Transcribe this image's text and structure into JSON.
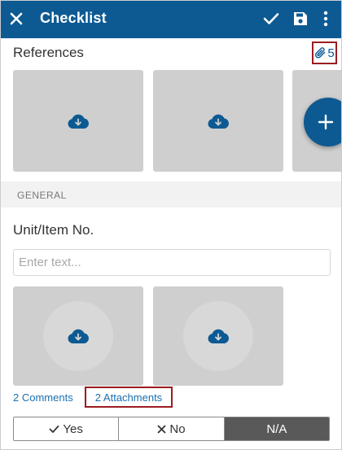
{
  "appbar": {
    "title": "Checklist",
    "icons": [
      "close-icon",
      "check-icon",
      "save-icon",
      "more-vertical-icon"
    ]
  },
  "references": {
    "title": "References",
    "attachment_count": "5",
    "attachment_icon": "paperclip-icon",
    "thumbnails": [
      "cloud-download-icon",
      "cloud-download-icon",
      "cloud-download-icon"
    ],
    "add_icon": "plus-icon"
  },
  "section": {
    "title": "GENERAL"
  },
  "question": {
    "label": "Unit/Item No.",
    "input": {
      "value": "",
      "placeholder": "Enter text..."
    },
    "comments_link": "2 Comments",
    "attachments_link": "2 Attachments",
    "options": [
      {
        "label": "Yes",
        "icon": "check-icon",
        "selected": false
      },
      {
        "label": "No",
        "icon": "x-icon",
        "selected": false
      },
      {
        "label": "N/A",
        "icon": "",
        "selected": true
      }
    ]
  },
  "colors": {
    "primary": "#0d5a93",
    "highlight": "#9b1d20",
    "thumbnail": "#cfcfcf",
    "selected_segment": "#595959",
    "link": "#1a6fb0"
  }
}
